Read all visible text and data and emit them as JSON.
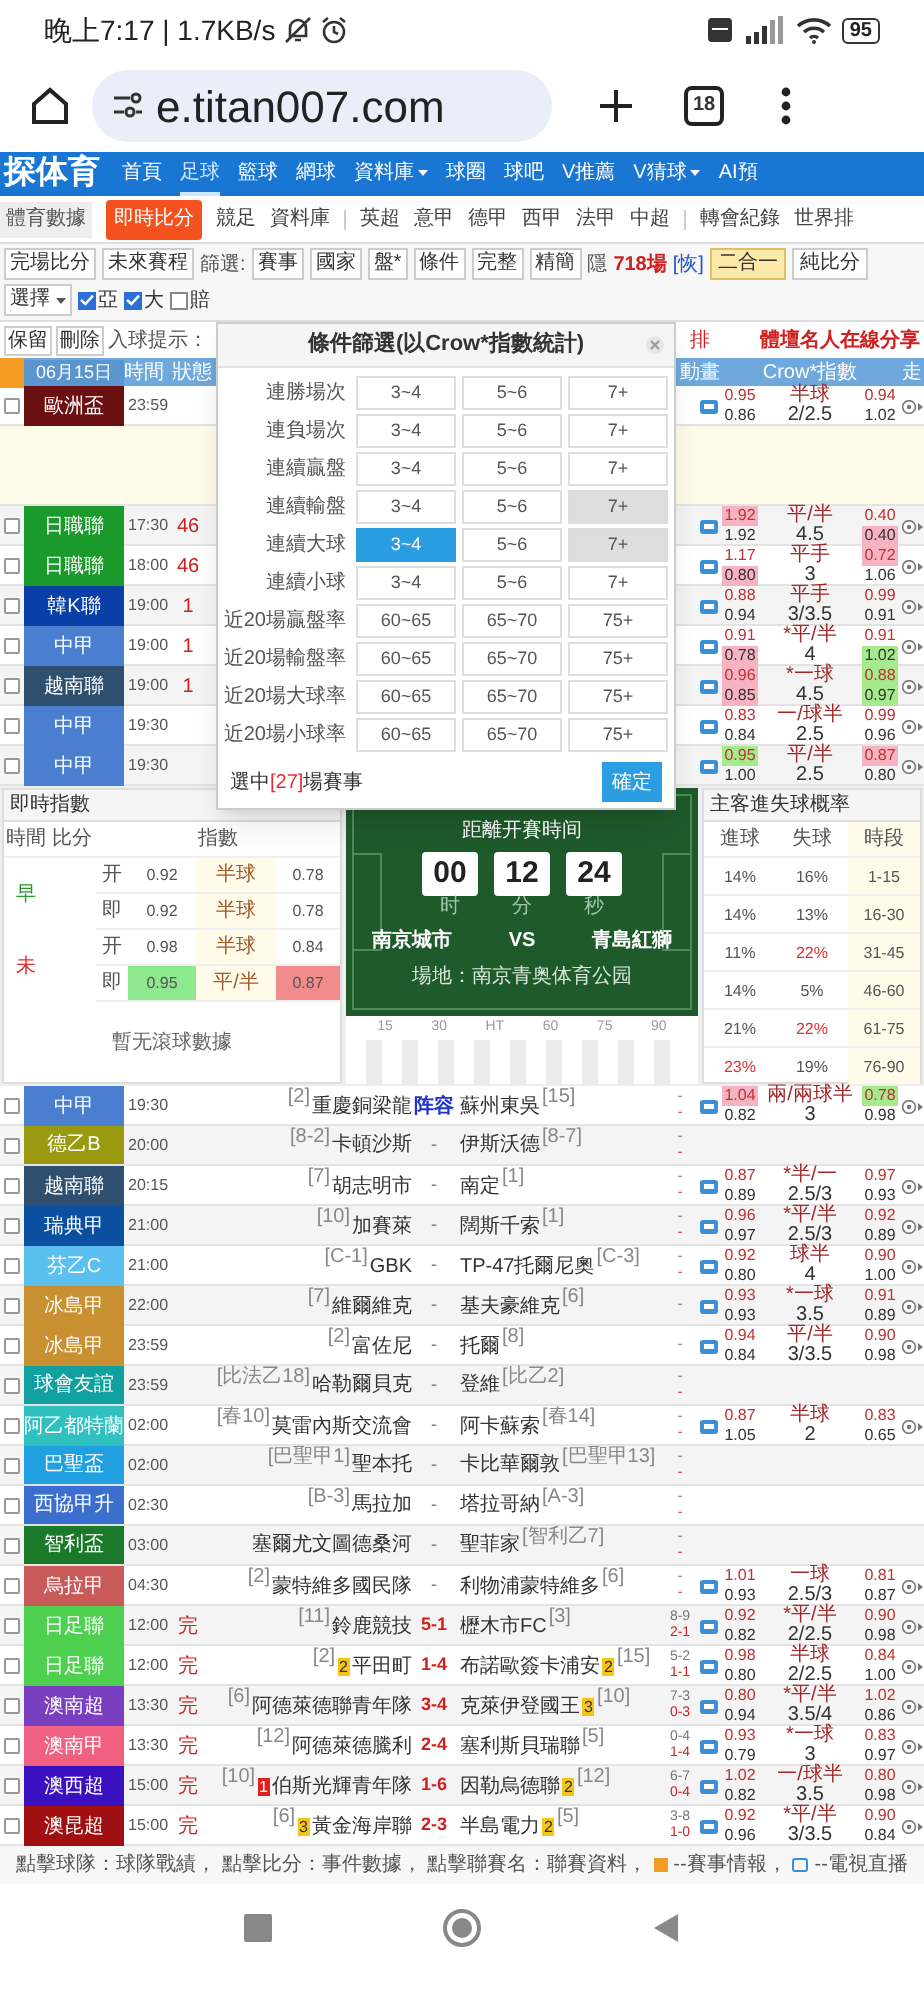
{
  "status_bar": {
    "time": "晚上7:17 | 1.7KB/s",
    "battery": "95"
  },
  "browser": {
    "url": "e.titan007.com",
    "tab_count": "18"
  },
  "site_nav": {
    "logo": "探体育",
    "items": [
      {
        "label": "首頁",
        "selected": false,
        "dropdown": false
      },
      {
        "label": "足球",
        "selected": true,
        "dropdown": false
      },
      {
        "label": "籃球",
        "selected": false,
        "dropdown": false
      },
      {
        "label": "網球",
        "selected": false,
        "dropdown": false
      },
      {
        "label": "資料庫",
        "selected": false,
        "dropdown": true
      },
      {
        "label": "球圈",
        "selected": false,
        "dropdown": false
      },
      {
        "label": "球吧",
        "selected": false,
        "dropdown": false
      },
      {
        "label": "V推薦",
        "selected": false,
        "dropdown": false
      },
      {
        "label": "V猜球",
        "selected": false,
        "dropdown": true
      },
      {
        "label": "AI預",
        "selected": false,
        "dropdown": false
      }
    ]
  },
  "sub_nav": {
    "brand": "體育數據",
    "groups": [
      [
        {
          "label": "即時比分",
          "selected": true
        },
        {
          "label": "競足",
          "selected": false
        },
        {
          "label": "資料庫",
          "selected": false
        }
      ],
      [
        {
          "label": "英超",
          "selected": false
        },
        {
          "label": "意甲",
          "selected": false
        },
        {
          "label": "德甲",
          "selected": false
        },
        {
          "label": "西甲",
          "selected": false
        },
        {
          "label": "法甲",
          "selected": false
        },
        {
          "label": "中超",
          "selected": false
        }
      ],
      [
        {
          "label": "轉會紀錄",
          "selected": false
        },
        {
          "label": "世界排",
          "selected": false
        }
      ]
    ]
  },
  "toolbar": [
    {
      "kind": "button",
      "label": "完場比分"
    },
    {
      "kind": "button",
      "label": "未來賽程"
    },
    {
      "kind": "label",
      "label": "篩選:"
    },
    {
      "kind": "button",
      "label": "賽事"
    },
    {
      "kind": "button",
      "label": "國家"
    },
    {
      "kind": "button",
      "label": "盤*"
    },
    {
      "kind": "button",
      "label": "條件"
    },
    {
      "kind": "button",
      "label": "完整"
    },
    {
      "kind": "button",
      "label": "精簡"
    },
    {
      "kind": "hidden",
      "label": "隱",
      "count": "718場",
      "link": "[恢]"
    },
    {
      "kind": "toggle",
      "label": "二合一",
      "selected": true
    },
    {
      "kind": "toggle",
      "label": "純比分",
      "selected": false
    },
    {
      "kind": "select",
      "label": "選擇"
    },
    {
      "kind": "checkbox",
      "label": "亞",
      "checked": true
    },
    {
      "kind": "checkbox",
      "label": "大",
      "checked": true
    },
    {
      "kind": "checkbox",
      "label": "賠",
      "checked": false
    }
  ],
  "action_bar": {
    "buttons": [
      "保留",
      "刪除"
    ],
    "goal_alert": "入球提示：",
    "notice": "排",
    "promo": "體壇名人在線分享"
  },
  "table": {
    "date": "06月15日",
    "columns": [
      "時間",
      "狀態",
      "動畫",
      "Crow*指數",
      "走"
    ],
    "top_rows": [
      {
        "league": "歐洲盃",
        "color": "#6b1010",
        "time": "23:59",
        "status": "",
        "checked": false,
        "tv": true,
        "expanded": true,
        "odds": [
          [
            "0.95",
            "0.86"
          ],
          [
            "半球",
            "2/2.5"
          ],
          [
            "0.94",
            "1.02"
          ]
        ]
      },
      {
        "league": "日職聯",
        "color": "#1a9a2a",
        "time": "17:30",
        "status": "46",
        "checked": false,
        "tv": true,
        "expanded": false,
        "odds": [
          [
            {
              "value": "1.92",
              "rise": true
            },
            "1.92"
          ],
          [
            "平/半",
            "4.5"
          ],
          [
            "0.40",
            {
              "value": "0.40",
              "rise": true
            }
          ]
        ]
      },
      {
        "league": "日職聯",
        "color": "#1a9a2a",
        "time": "18:00",
        "status": "46",
        "checked": false,
        "tv": true,
        "expanded": false,
        "odds": [
          [
            "1.17",
            {
              "value": "0.80",
              "rise": true
            }
          ],
          [
            "平手",
            "3"
          ],
          [
            {
              "value": "0.72",
              "rise": true
            },
            "1.06"
          ]
        ]
      },
      {
        "league": "韓K聯",
        "color": "#0b3fa8",
        "time": "19:00",
        "status": "1",
        "checked": false,
        "tv": true,
        "expanded": false,
        "odds": [
          [
            "0.88",
            "0.94"
          ],
          [
            "平手",
            "3/3.5"
          ],
          [
            "0.99",
            "0.91"
          ]
        ]
      },
      {
        "league": "中甲",
        "color": "#4a7fd0",
        "time": "19:00",
        "status": "1",
        "checked": false,
        "tv": true,
        "expanded": false,
        "odds": [
          [
            "0.91",
            {
              "value": "0.78",
              "rise": true
            }
          ],
          [
            "*平/半",
            "4"
          ],
          [
            "0.91",
            {
              "value": "1.02",
              "rise": false
            }
          ]
        ]
      },
      {
        "league": "越南聯",
        "color": "#2f4f6f",
        "time": "19:00",
        "status": "1",
        "checked": false,
        "tv": true,
        "expanded": false,
        "odds": [
          [
            {
              "value": "0.96",
              "rise": true
            },
            {
              "value": "0.85",
              "rise": true
            }
          ],
          [
            "*一球",
            "4.5"
          ],
          [
            {
              "value": "0.88",
              "rise": false
            },
            {
              "value": "0.97",
              "rise": false
            }
          ]
        ]
      },
      {
        "league": "中甲",
        "color": "#4a7fd0",
        "time": "19:30",
        "status": "",
        "checked": false,
        "tv": true,
        "expanded": false,
        "odds": [
          [
            "0.83",
            "0.84"
          ],
          [
            "一/球半",
            "2.5"
          ],
          [
            "0.99",
            "0.96"
          ]
        ]
      },
      {
        "league": "中甲",
        "color": "#4a7fd0",
        "time": "19:30",
        "status": "",
        "checked": false,
        "tv": true,
        "expanded": false,
        "odds": [
          [
            {
              "value": "0.95",
              "rise": false
            },
            "1.00"
          ],
          [
            "平/半",
            "2.5"
          ],
          [
            {
              "value": "0.87",
              "rise": true
            },
            "0.80"
          ]
        ]
      }
    ],
    "rows": [
      {
        "league": "中甲",
        "color": "#4a7fd0",
        "time": "19:30",
        "status": "",
        "checked": false,
        "home": {
          "rank": "[2]",
          "name": "重慶銅梁龍"
        },
        "score": {
          "kind": "lineup",
          "text": "阵容"
        },
        "away": {
          "name": "蘇州東吳",
          "rank": "[15]"
        },
        "half": [
          "-",
          "-"
        ],
        "tv": true,
        "odds": [
          [
            {
              "value": "1.04",
              "rise": true
            },
            "0.82"
          ],
          [
            "兩/兩球半",
            "3"
          ],
          [
            {
              "value": "0.78",
              "rise": false
            },
            "0.98"
          ]
        ]
      },
      {
        "league": "德乙B",
        "color": "#9a9a10",
        "time": "20:00",
        "status": "",
        "checked": false,
        "home": {
          "rank": "[8-2]",
          "name": "卡頓沙斯"
        },
        "score": {
          "kind": "none",
          "text": "-"
        },
        "away": {
          "name": "伊斯沃德",
          "rank": "[8-7]"
        },
        "half": [
          "-",
          "-"
        ],
        "tv": false
      },
      {
        "league": "越南聯",
        "color": "#2f4f6f",
        "time": "20:15",
        "status": "",
        "checked": false,
        "home": {
          "rank": "[7]",
          "name": "胡志明市"
        },
        "score": {
          "kind": "none",
          "text": "-"
        },
        "away": {
          "name": "南定",
          "rank": "[1]"
        },
        "half": [
          "-",
          "-"
        ],
        "tv": true,
        "odds": [
          [
            "0.87",
            "0.89"
          ],
          [
            "*半/一",
            "2.5/3"
          ],
          [
            "0.97",
            "0.93"
          ]
        ]
      },
      {
        "league": "瑞典甲",
        "color": "#0b4fa0",
        "time": "21:00",
        "status": "",
        "checked": false,
        "home": {
          "rank": "[10]",
          "name": "加賽萊"
        },
        "score": {
          "kind": "none",
          "text": "-"
        },
        "away": {
          "name": "闊斯千索",
          "rank": "[1]"
        },
        "half": [
          "-",
          "-"
        ],
        "tv": true,
        "odds": [
          [
            "0.96",
            "0.97"
          ],
          [
            "*平/半",
            "2.5/3"
          ],
          [
            "0.92",
            "0.89"
          ]
        ]
      },
      {
        "league": "芬乙C",
        "color": "#5bc0f0",
        "time": "21:00",
        "status": "",
        "checked": false,
        "home": {
          "rank": "[C-1]",
          "name": "GBK"
        },
        "score": {
          "kind": "none",
          "text": "-"
        },
        "away": {
          "name": "TP-47托爾尼奧",
          "rank": "[C-3]"
        },
        "half": [
          "-",
          "-"
        ],
        "tv": true,
        "odds": [
          [
            "0.92",
            "0.80"
          ],
          [
            "球半",
            "4"
          ],
          [
            "0.90",
            "1.00"
          ]
        ]
      },
      {
        "league": "冰島甲",
        "color": "#c89030",
        "time": "22:00",
        "status": "",
        "checked": false,
        "home": {
          "rank": "[7]",
          "name": "維爾維克"
        },
        "score": {
          "kind": "none",
          "text": "-"
        },
        "away": {
          "name": "基夫豪維克",
          "rank": "[6]"
        },
        "half": [
          "-"
        ],
        "tv": true,
        "odds": [
          [
            "0.93",
            "0.93"
          ],
          [
            "*一球",
            "3.5"
          ],
          [
            "0.91",
            "0.89"
          ]
        ]
      },
      {
        "league": "冰島甲",
        "color": "#c89030",
        "time": "23:59",
        "status": "",
        "checked": false,
        "home": {
          "rank": "[2]",
          "name": "富佐尼"
        },
        "score": {
          "kind": "none",
          "text": "-"
        },
        "away": {
          "name": "托爾",
          "rank": "[8]"
        },
        "half": [
          "-"
        ],
        "tv": true,
        "odds": [
          [
            "0.94",
            "0.84"
          ],
          [
            "平/半",
            "3/3.5"
          ],
          [
            "0.90",
            "0.98"
          ]
        ]
      },
      {
        "league": "球會友誼",
        "color": "#10a0a0",
        "time": "23:59",
        "status": "",
        "checked": false,
        "home": {
          "rank": "[比法乙18]",
          "name": "哈勒爾貝克"
        },
        "score": {
          "kind": "none",
          "text": "-"
        },
        "away": {
          "name": "登維",
          "rank": "[比乙2]"
        },
        "half": [
          "-",
          "-"
        ],
        "tv": false
      },
      {
        "league": "阿乙都特蘭",
        "color": "#30c0c0",
        "time": "02:00",
        "status": "",
        "checked": false,
        "home": {
          "rank": "[春10]",
          "name": "莫雷內斯交流會"
        },
        "score": {
          "kind": "none",
          "text": "-"
        },
        "away": {
          "name": "阿卡蘇索",
          "rank": "[春14]"
        },
        "half": [
          "-",
          "-"
        ],
        "tv": true,
        "odds": [
          [
            "0.87",
            "1.05"
          ],
          [
            "半球",
            "2"
          ],
          [
            "0.83",
            "0.65"
          ]
        ]
      },
      {
        "league": "巴聖盃",
        "color": "#20a0e0",
        "time": "02:00",
        "status": "",
        "checked": false,
        "home": {
          "rank": "[巴聖甲1]",
          "name": "聖本托"
        },
        "score": {
          "kind": "none",
          "text": "-"
        },
        "away": {
          "name": "卡比華爾敦",
          "rank": "[巴聖甲13]"
        },
        "half": [
          "-",
          "-"
        ],
        "tv": false
      },
      {
        "league": "西協甲升",
        "color": "#3a6fd0",
        "time": "02:30",
        "status": "",
        "checked": false,
        "home": {
          "rank": "[B-3]",
          "name": "馬拉加"
        },
        "score": {
          "kind": "none",
          "text": "-"
        },
        "away": {
          "name": "塔拉哥納",
          "rank": "[A-3]"
        },
        "half": [
          "-",
          "-"
        ],
        "tv": false
      },
      {
        "league": "智利盃",
        "color": "#1a7a2a",
        "time": "03:00",
        "status": "",
        "checked": false,
        "home": {
          "name": "塞爾尤文圖德桑河"
        },
        "score": {
          "kind": "none",
          "text": "-"
        },
        "away": {
          "name": "聖菲家",
          "rank": "[智利乙7]"
        },
        "half": [
          "-",
          "-"
        ],
        "tv": false
      },
      {
        "league": "烏拉甲",
        "color": "#c85a5a",
        "time": "04:30",
        "status": "",
        "checked": false,
        "home": {
          "rank": "[2]",
          "name": "蒙特維多國民隊"
        },
        "score": {
          "kind": "none",
          "text": "-"
        },
        "away": {
          "name": "利物浦蒙特維多",
          "rank": "[6]"
        },
        "half": [
          "-",
          "-"
        ],
        "tv": true,
        "odds": [
          [
            "1.01",
            "0.93"
          ],
          [
            "一球",
            "2.5/3"
          ],
          [
            "0.81",
            "0.87"
          ]
        ]
      },
      {
        "league": "日足聯",
        "color": "#50d050",
        "time": "12:00",
        "status": "完",
        "checked": false,
        "home": {
          "rank": "[11]",
          "name": "鈴鹿競技"
        },
        "score": {
          "kind": "final",
          "text": "5-1"
        },
        "away": {
          "name": "櫪木市FC",
          "rank": "[3]"
        },
        "half": [
          "8-9",
          "2-1"
        ],
        "tv": true,
        "odds": [
          [
            "0.92",
            "0.82"
          ],
          [
            "*平/半",
            "2/2.5"
          ],
          [
            "0.90",
            "0.98"
          ]
        ]
      },
      {
        "league": "日足聯",
        "color": "#50d050",
        "time": "12:00",
        "status": "完",
        "checked": false,
        "home": {
          "rank": "[2]",
          "card": {
            "count": "2",
            "kind": "yellow"
          },
          "name": "平田町"
        },
        "score": {
          "kind": "final",
          "text": "1-4"
        },
        "away": {
          "name": "布諾歐簽卡浦安",
          "card": {
            "count": "2",
            "kind": "yellow"
          },
          "rank": "[15]"
        },
        "half": [
          "5-2",
          "1-1"
        ],
        "tv": true,
        "odds": [
          [
            "0.98",
            "0.80"
          ],
          [
            "半球",
            "2/2.5"
          ],
          [
            "0.84",
            "1.00"
          ]
        ]
      },
      {
        "league": "澳南超",
        "color": "#7a3fc0",
        "time": "13:30",
        "status": "完",
        "checked": false,
        "home": {
          "rank": "[6]",
          "name": "阿德萊德聯青年隊"
        },
        "score": {
          "kind": "final",
          "text": "3-4"
        },
        "away": {
          "name": "克萊伊登國王",
          "card": {
            "count": "3",
            "kind": "yellow"
          },
          "rank": "[10]"
        },
        "half": [
          "7-3",
          "0-3"
        ],
        "tv": true,
        "odds": [
          [
            "0.80",
            "0.94"
          ],
          [
            "*平/半",
            "3.5/4"
          ],
          [
            "1.02",
            "0.86"
          ]
        ]
      },
      {
        "league": "澳南甲",
        "color": "#f06080",
        "time": "13:30",
        "status": "完",
        "checked": false,
        "home": {
          "rank": "[12]",
          "name": "阿德萊德騰利"
        },
        "score": {
          "kind": "final",
          "text": "2-4"
        },
        "away": {
          "name": "塞利斯貝瑞聯",
          "rank": "[5]"
        },
        "half": [
          "0-4",
          "1-4"
        ],
        "tv": true,
        "odds": [
          [
            "0.93",
            "0.79"
          ],
          [
            "*一球",
            "3"
          ],
          [
            "0.83",
            "0.97"
          ]
        ]
      },
      {
        "league": "澳西超",
        "color": "#3a10c0",
        "time": "15:00",
        "status": "完",
        "checked": false,
        "home": {
          "rank": "[10]",
          "card": {
            "count": "1",
            "kind": "red"
          },
          "name": "伯斯光輝青年隊"
        },
        "score": {
          "kind": "final",
          "text": "1-6"
        },
        "away": {
          "name": "因勒烏德聯",
          "card": {
            "count": "2",
            "kind": "yellow"
          },
          "rank": "[12]"
        },
        "half": [
          "6-7",
          "0-4"
        ],
        "tv": true,
        "odds": [
          [
            "1.02",
            "0.82"
          ],
          [
            "一/球半",
            "3.5"
          ],
          [
            "0.80",
            "0.98"
          ]
        ]
      },
      {
        "league": "澳昆超",
        "color": "#a01010",
        "time": "15:00",
        "status": "完",
        "checked": false,
        "home": {
          "rank": "[6]",
          "card": {
            "count": "3",
            "kind": "yellow"
          },
          "name": "黃金海岸聯"
        },
        "score": {
          "kind": "final",
          "text": "2-3"
        },
        "away": {
          "name": "半島電力",
          "card": {
            "count": "2",
            "kind": "yellow"
          },
          "rank": "[5]"
        },
        "half": [
          "3-8",
          "1-0"
        ],
        "tv": true,
        "odds": [
          [
            "0.92",
            "0.96"
          ],
          [
            "*平/半",
            "3/3.5"
          ],
          [
            "0.90",
            "0.84"
          ]
        ]
      }
    ],
    "footer_note": [
      {
        "kind": "text",
        "text": "點擊球隊：球隊戰績， 點擊比分：事件數據， 點擊聯賽名：聯賽資料，"
      },
      {
        "kind": "info",
        "text": "--賽事情報，"
      },
      {
        "kind": "tv",
        "text": "--電視直播"
      }
    ]
  },
  "filter_dialog": {
    "title": "條件篩選(以Crow*指數統計)",
    "rows": [
      {
        "label": "連勝場次",
        "options": [
          {
            "label": "3~4",
            "selected": false,
            "disabled": false
          },
          {
            "label": "5~6",
            "selected": false,
            "disabled": false
          },
          {
            "label": "7+",
            "selected": false,
            "disabled": false
          }
        ]
      },
      {
        "label": "連負場次",
        "options": [
          {
            "label": "3~4",
            "selected": false,
            "disabled": false
          },
          {
            "label": "5~6",
            "selected": false,
            "disabled": false
          },
          {
            "label": "7+",
            "selected": false,
            "disabled": false
          }
        ]
      },
      {
        "label": "連續贏盤",
        "options": [
          {
            "label": "3~4",
            "selected": false,
            "disabled": false
          },
          {
            "label": "5~6",
            "selected": false,
            "disabled": false
          },
          {
            "label": "7+",
            "selected": false,
            "disabled": false
          }
        ]
      },
      {
        "label": "連續輸盤",
        "options": [
          {
            "label": "3~4",
            "selected": false,
            "disabled": false
          },
          {
            "label": "5~6",
            "selected": false,
            "disabled": false
          },
          {
            "label": "7+",
            "selected": false,
            "disabled": true
          }
        ]
      },
      {
        "label": "連續大球",
        "options": [
          {
            "label": "3~4",
            "selected": true,
            "disabled": false
          },
          {
            "label": "5~6",
            "selected": false,
            "disabled": false
          },
          {
            "label": "7+",
            "selected": false,
            "disabled": true
          }
        ]
      },
      {
        "label": "連續小球",
        "options": [
          {
            "label": "3~4",
            "selected": false,
            "disabled": false
          },
          {
            "label": "5~6",
            "selected": false,
            "disabled": false
          },
          {
            "label": "7+",
            "selected": false,
            "disabled": false
          }
        ]
      },
      {
        "label": "近20場贏盤率",
        "options": [
          {
            "label": "60~65",
            "selected": false,
            "disabled": false
          },
          {
            "label": "65~70",
            "selected": false,
            "disabled": false
          },
          {
            "label": "75+",
            "selected": false,
            "disabled": false
          }
        ]
      },
      {
        "label": "近20場輸盤率",
        "options": [
          {
            "label": "60~65",
            "selected": false,
            "disabled": false
          },
          {
            "label": "65~70",
            "selected": false,
            "disabled": false
          },
          {
            "label": "75+",
            "selected": false,
            "disabled": false
          }
        ]
      },
      {
        "label": "近20場大球率",
        "options": [
          {
            "label": "60~65",
            "selected": false,
            "disabled": false
          },
          {
            "label": "65~70",
            "selected": false,
            "disabled": false
          },
          {
            "label": "75+",
            "selected": false,
            "disabled": false
          }
        ]
      },
      {
        "label": "近20場小球率",
        "options": [
          {
            "label": "60~65",
            "selected": false,
            "disabled": false
          },
          {
            "label": "65~70",
            "selected": false,
            "disabled": false
          },
          {
            "label": "75+",
            "selected": false,
            "disabled": false
          }
        ]
      }
    ],
    "summary_prefix": "選中",
    "count": "[27]",
    "summary_suffix": "場賽事",
    "confirm": "確定"
  },
  "live_odds": {
    "title": "即時指數",
    "columns": [
      "時間",
      "比分",
      "指數"
    ],
    "groups": [
      {
        "period": "早",
        "color": "#2a9a2a",
        "rows": [
          {
            "type": "开",
            "odds": [
              "0.92",
              "半球",
              "0.78"
            ]
          },
          {
            "type": "即",
            "odds": [
              "0.92",
              "半球",
              "0.78"
            ]
          }
        ]
      },
      {
        "period": "未",
        "color": "#e03030",
        "rows": [
          {
            "type": "开",
            "odds": [
              "0.98",
              "半球",
              "0.84"
            ]
          },
          {
            "type": "即",
            "odds": [
              {
                "value": "0.95",
                "rise": false
              },
              "平/半",
              {
                "value": "0.87",
                "rise": true
              }
            ]
          }
        ]
      }
    ],
    "empty_note": "暫无滾球數據"
  },
  "countdown": {
    "title": "距離开賽時间",
    "units": [
      {
        "value": "00",
        "label": "时"
      },
      {
        "value": "12",
        "label": "分"
      },
      {
        "value": "24",
        "label": "秒"
      }
    ],
    "home": "南京城市",
    "vs": "VS",
    "away": "青島紅獅",
    "venue": "場地：南京青奥体育公园",
    "timeline": [
      "15",
      "30",
      "HT",
      "60",
      "75",
      "90"
    ]
  },
  "goal_probability": {
    "title": "主客進失球概率",
    "columns": [
      "進球",
      "失球",
      "時段"
    ],
    "rows": [
      {
        "scored": "14%",
        "conceded": "16%",
        "period": "1-15",
        "scored_hot": false,
        "conceded_hot": false
      },
      {
        "scored": "14%",
        "conceded": "13%",
        "period": "16-30",
        "scored_hot": false,
        "conceded_hot": false
      },
      {
        "scored": "11%",
        "conceded": "22%",
        "period": "31-45",
        "scored_hot": false,
        "conceded_hot": true
      },
      {
        "scored": "14%",
        "conceded": "5%",
        "period": "46-60",
        "scored_hot": false,
        "conceded_hot": false
      },
      {
        "scored": "21%",
        "conceded": "22%",
        "period": "61-75",
        "scored_hot": false,
        "conceded_hot": true
      },
      {
        "scored": "23%",
        "conceded": "19%",
        "period": "76-90",
        "scored_hot": true,
        "conceded_hot": false
      }
    ]
  }
}
